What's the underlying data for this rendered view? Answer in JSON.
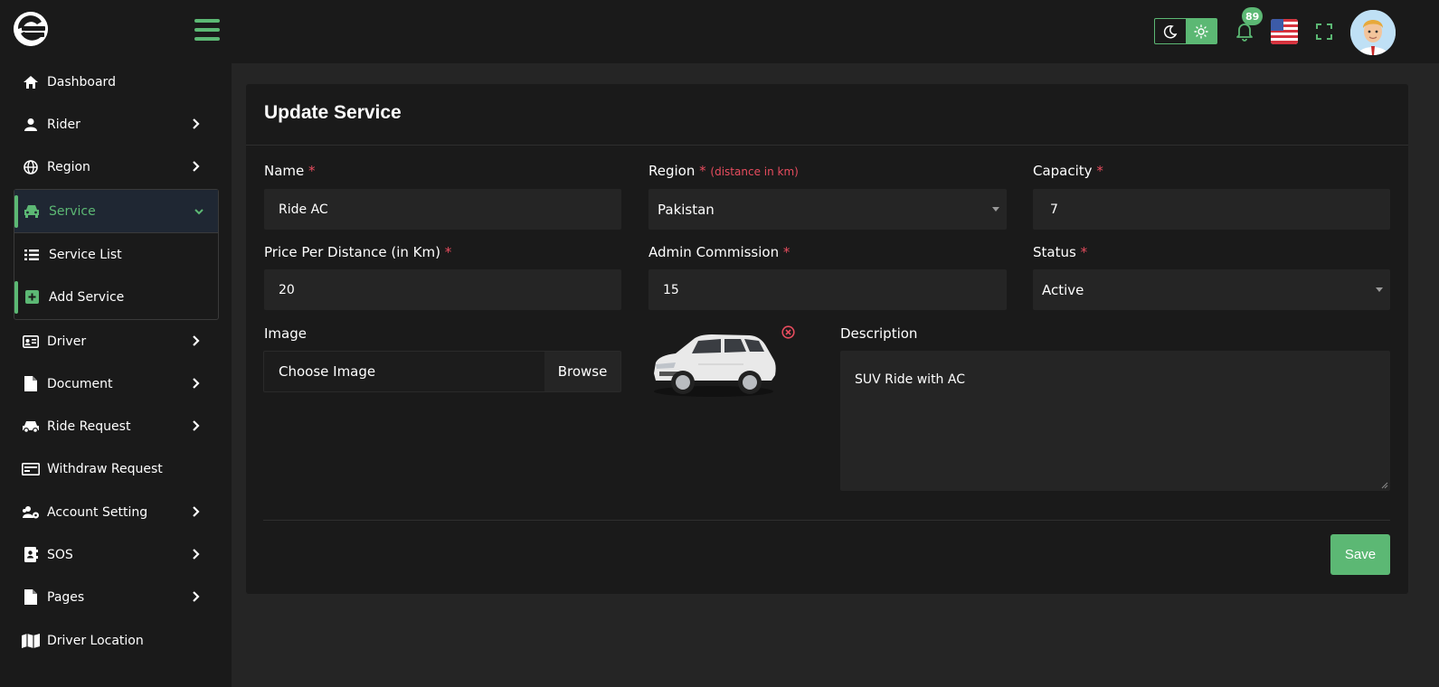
{
  "header": {
    "notification_count": "89",
    "flag_icon": "us-flag-icon",
    "colors": {
      "accent": "#5cb874",
      "background": "#252525",
      "panel": "#1a1a1a",
      "required": "#e74c5e"
    }
  },
  "sidebar": {
    "items": [
      {
        "label": "Dashboard",
        "icon": "home-icon"
      },
      {
        "label": "Rider",
        "icon": "user-icon"
      },
      {
        "label": "Region",
        "icon": "globe-icon"
      },
      {
        "label": "Service",
        "icon": "car-icon"
      },
      {
        "label": "Driver",
        "icon": "id-card-icon"
      },
      {
        "label": "Document",
        "icon": "file-icon"
      },
      {
        "label": "Ride Request",
        "icon": "car-icon"
      },
      {
        "label": "Withdraw Request",
        "icon": "money-icon"
      },
      {
        "label": "Account Setting",
        "icon": "users-cog-icon"
      },
      {
        "label": "SOS",
        "icon": "address-book-icon"
      },
      {
        "label": "Pages",
        "icon": "file-icon"
      },
      {
        "label": "Driver Location",
        "icon": "map-icon"
      }
    ],
    "service_sub": [
      {
        "label": "Service List",
        "icon": "list-icon"
      },
      {
        "label": "Add Service",
        "icon": "plus-square-icon"
      }
    ]
  },
  "form": {
    "title": "Update Service",
    "required_mark": "*",
    "name": {
      "label": "Name",
      "value": "Ride AC"
    },
    "region": {
      "label": "Region",
      "hint": "(distance in km)",
      "value": "Pakistan"
    },
    "capacity": {
      "label": "Capacity",
      "value": "7"
    },
    "price": {
      "label": "Price Per Distance (in Km)",
      "value": "20"
    },
    "commission": {
      "label": "Admin Commission",
      "value": "15"
    },
    "status": {
      "label": "Status",
      "value": "Active"
    },
    "image": {
      "label": "Image",
      "placeholder": "Choose Image",
      "browse_label": "Browse"
    },
    "description": {
      "label": "Description",
      "value": "SUV Ride with AC"
    },
    "save_label": "Save"
  }
}
